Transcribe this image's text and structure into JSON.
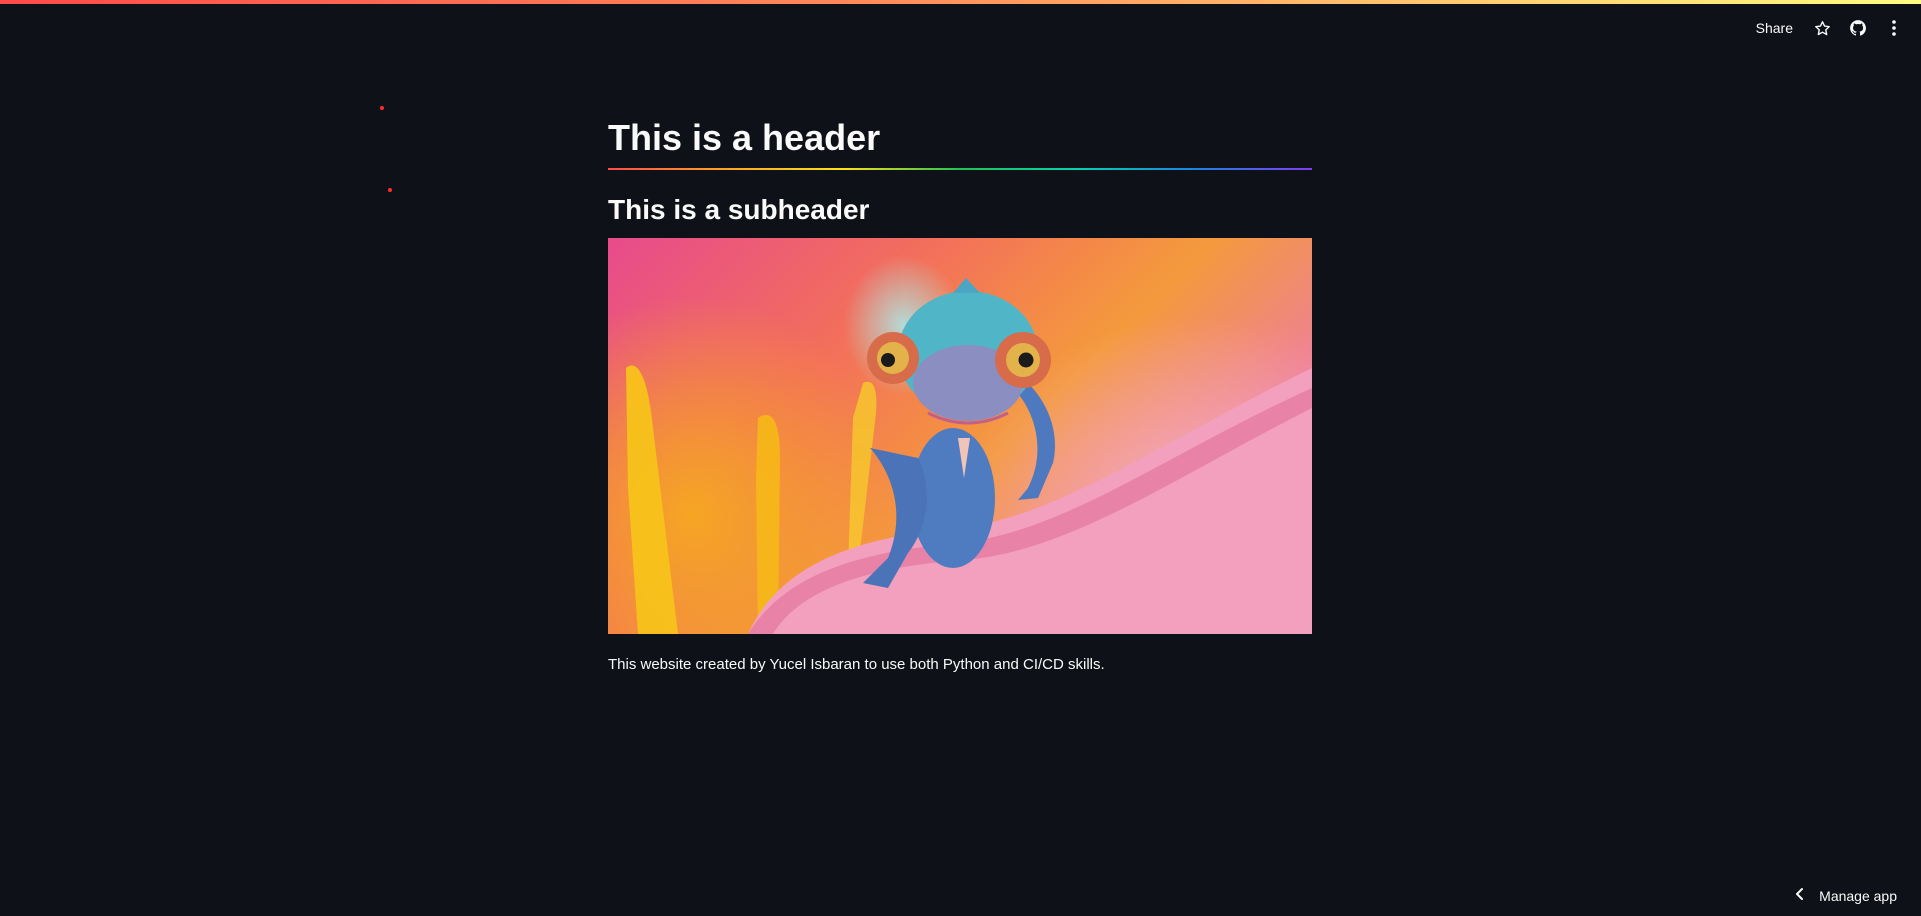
{
  "toolbar": {
    "share_label": "Share",
    "icons": [
      "star-icon",
      "github-icon",
      "more-vertical-icon"
    ]
  },
  "main": {
    "header": "This is a header",
    "subheader": "This is a subheader",
    "image": {
      "subject": "colorful chameleon on a pink flower petal"
    },
    "caption": "This website created by Yucel Isbaran to use both Python and CI/CD skills."
  },
  "footer": {
    "manage_label": "Manage app",
    "icon": "chevron-left-icon"
  },
  "colors": {
    "background": "#0e1117",
    "text": "#fafafa",
    "accent": "#ff4b4b"
  }
}
